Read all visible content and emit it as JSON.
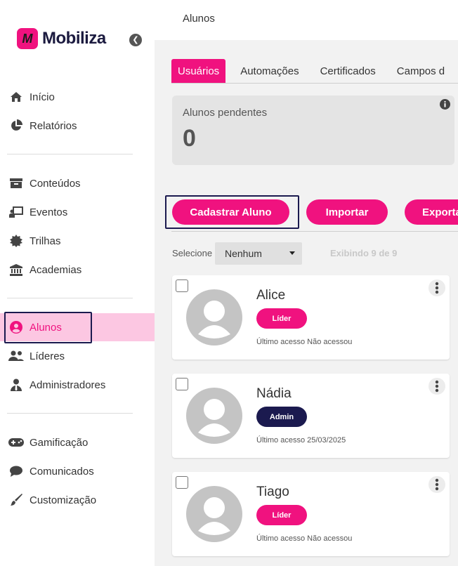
{
  "brand": {
    "logo_mark": "M",
    "name": "Mobiliza",
    "accent": "#f0127f",
    "dark": "#1b1a4f"
  },
  "page": {
    "title": "Alunos"
  },
  "sidebar": {
    "groups": [
      [
        {
          "label": "Início",
          "icon": "home-icon"
        },
        {
          "label": "Relatórios",
          "icon": "pie-chart-icon"
        }
      ],
      [
        {
          "label": "Conteúdos",
          "icon": "archive-icon"
        },
        {
          "label": "Eventos",
          "icon": "presentation-icon"
        },
        {
          "label": "Trilhas",
          "icon": "gear-badge-icon"
        },
        {
          "label": "Academias",
          "icon": "bank-icon"
        }
      ],
      [
        {
          "label": "Alunos",
          "icon": "user-circle-icon",
          "active": true
        },
        {
          "label": "Líderes",
          "icon": "users-icon"
        },
        {
          "label": "Administradores",
          "icon": "user-tie-icon"
        }
      ],
      [
        {
          "label": "Gamificação",
          "icon": "gamepad-icon"
        },
        {
          "label": "Comunicados",
          "icon": "chat-bubble-icon"
        },
        {
          "label": "Customização",
          "icon": "paint-brush-icon"
        }
      ]
    ]
  },
  "tabs": [
    {
      "label": "Usuários",
      "active": true
    },
    {
      "label": "Automações"
    },
    {
      "label": "Certificados"
    },
    {
      "label": "Campos d"
    }
  ],
  "stats": {
    "pending_label": "Alunos pendentes",
    "pending_value": "0"
  },
  "actions": {
    "register": "Cadastrar Aluno",
    "import": "Importar",
    "export": "Exporta"
  },
  "filter": {
    "label": "Selecione",
    "selected": "Nenhum",
    "showing": "Exibindo 9 de 9"
  },
  "students": [
    {
      "name": "Alice",
      "role": "Líder",
      "role_type": "lider",
      "last_access": "Último acesso Não acessou"
    },
    {
      "name": "Nádia",
      "role": "Admin",
      "role_type": "admin",
      "last_access": "Último acesso 25/03/2025"
    },
    {
      "name": "Tiago",
      "role": "Líder",
      "role_type": "lider",
      "last_access": "Último acesso Não acessou"
    }
  ]
}
